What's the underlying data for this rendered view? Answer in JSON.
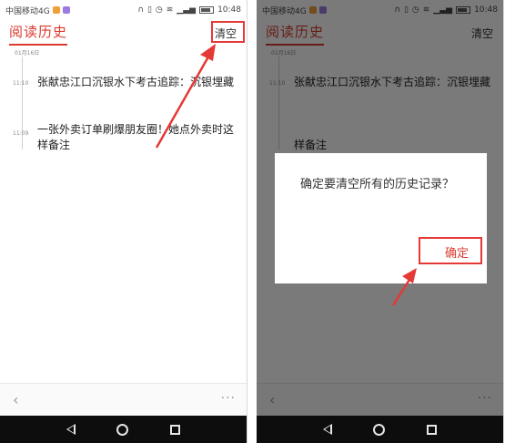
{
  "status_bar": {
    "carrier": "中国移动4G",
    "time": "10:48"
  },
  "header": {
    "title": "阅读历史",
    "clear_label": "清空"
  },
  "history": {
    "date": "01月16日",
    "items": [
      {
        "time": "11:10",
        "title": "张献忠江口沉银水下考古追踪：沉银埋藏"
      },
      {
        "time": "11:09",
        "title_line1": "一张外卖订单刷爆朋友圈！她点外卖时这",
        "title_line2": "样备注"
      }
    ]
  },
  "dialog": {
    "message": "确定要清空所有的历史记录？",
    "confirm_label": "确定"
  },
  "icons": {
    "back": "chevron-left-icon",
    "more": "more-dots-icon",
    "nav_back": "triangle-back-icon",
    "nav_home": "circle-home-icon",
    "nav_recent": "square-recent-icon"
  },
  "colors": {
    "accent": "#d93b2f",
    "annotation": "#e53935",
    "navbar": "#0d0d0d"
  }
}
